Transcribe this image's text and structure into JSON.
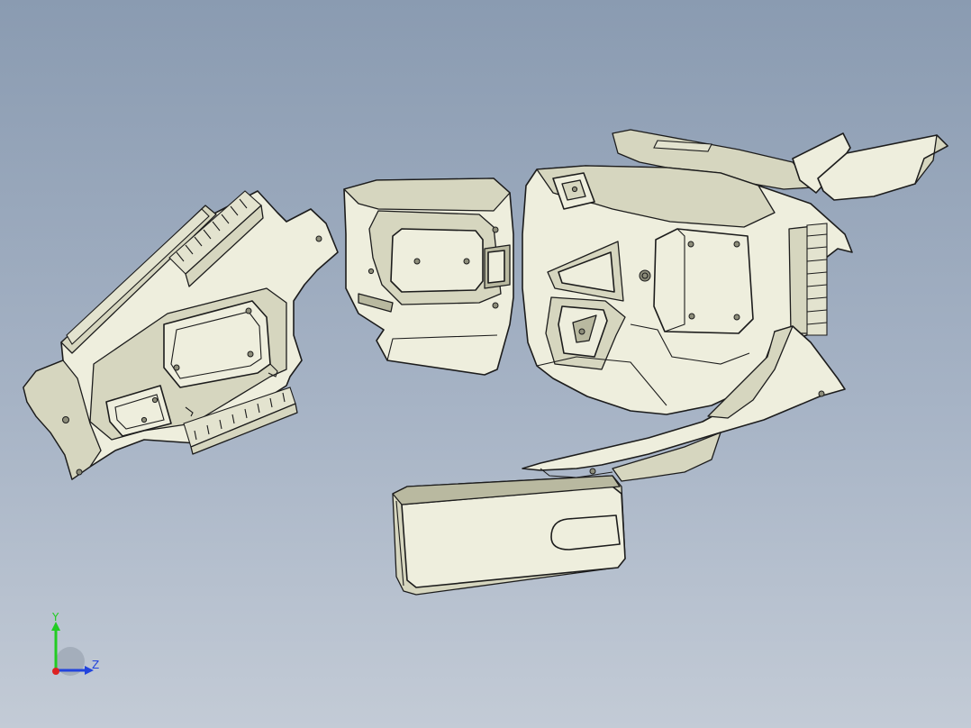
{
  "viewport": {
    "background_top": "#8a9bb1",
    "background_bottom": "#c3cbd6"
  },
  "model": {
    "part_fill": "#eeeedd",
    "edge_color": "#1c1c1c"
  },
  "triad": {
    "y_label": "Y",
    "z_label": "Z",
    "y_color": "#22cc22",
    "z_color": "#2244dd",
    "x_color": "#dd2222"
  }
}
